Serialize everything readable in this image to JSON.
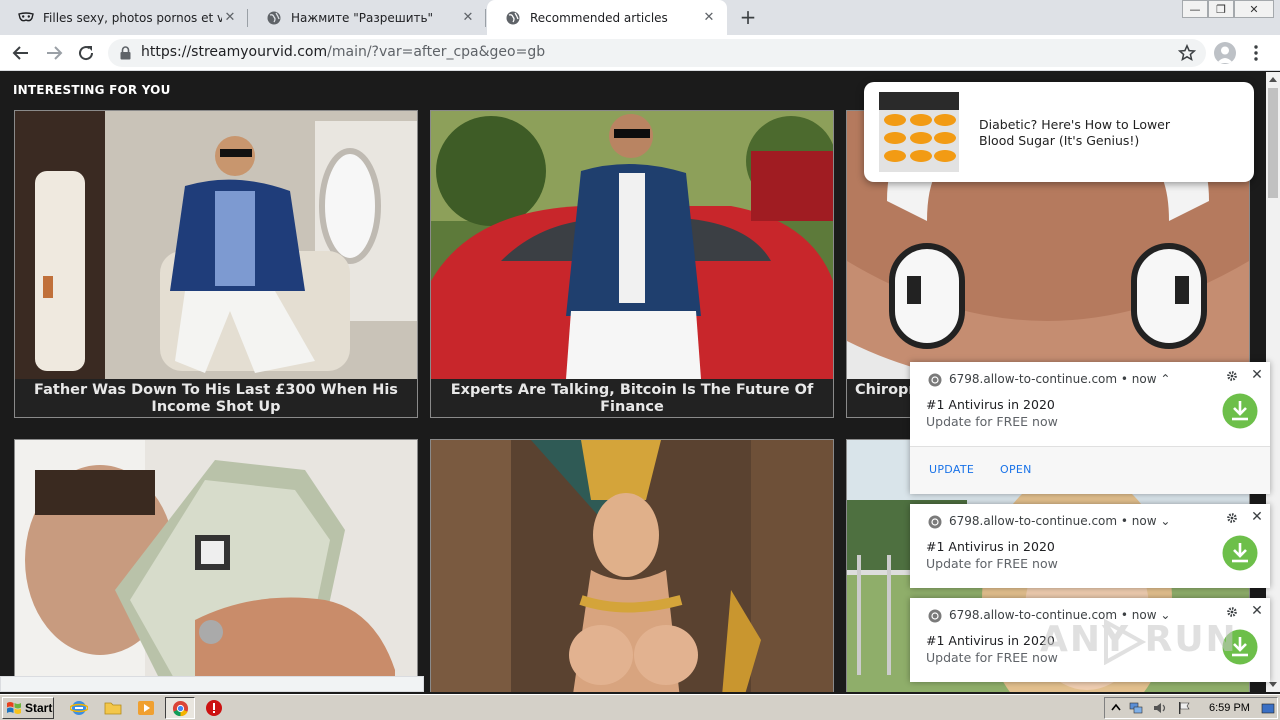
{
  "browser": {
    "tabs": [
      {
        "title": "Filles sexy, photos pornos et vidéos",
        "active": false
      },
      {
        "title": "Нажмите \"Разрешить\"",
        "active": false
      },
      {
        "title": "Recommended articles",
        "active": true
      }
    ],
    "new_tab_label": "+",
    "url_host": "https://streamyourvid.com",
    "url_path": "/main/?var=after_cpa&geo=gb",
    "window_controls": {
      "minimize": "—",
      "restore": "❐",
      "close": "✕"
    }
  },
  "page": {
    "section_title": "INTERESTING FOR YOU",
    "articles": [
      {
        "caption": "Father Was Down To His Last £300 When His Income Shot Up"
      },
      {
        "caption": "Experts Are Talking, Bitcoin Is The Future Of Finance"
      },
      {
        "caption": "Chiropr"
      },
      {
        "caption": ""
      },
      {
        "caption": ""
      },
      {
        "caption": ""
      }
    ]
  },
  "ad_popup": {
    "text": "Diabetic? Here's How to Lower Blood Sugar (It's Genius!)"
  },
  "notifications": [
    {
      "source": "6798.allow-to-continue.com • now",
      "chevron": "⌃",
      "title": "#1 Antivirus in 2020",
      "body": "Update for FREE now",
      "actions": [
        "UPDATE",
        "OPEN"
      ]
    },
    {
      "source": "6798.allow-to-continue.com • now",
      "chevron": "⌄",
      "title": "#1 Antivirus in 2020",
      "body": "Update for FREE now"
    },
    {
      "source": "6798.allow-to-continue.com • now",
      "chevron": "⌄",
      "title": "#1 Antivirus in 2020",
      "body": "Update for FREE now"
    }
  ],
  "watermark": {
    "text": "ANY RUN"
  },
  "taskbar": {
    "start_label": "Start",
    "clock": "6:59 PM"
  },
  "colors": {
    "page_bg": "#1b1b1b",
    "tabstrip_bg": "#dee1e6",
    "notification_action": "#1a73e8",
    "download_icon_green": "#6dbf4a",
    "taskbar_bg": "#d4d0c8"
  }
}
